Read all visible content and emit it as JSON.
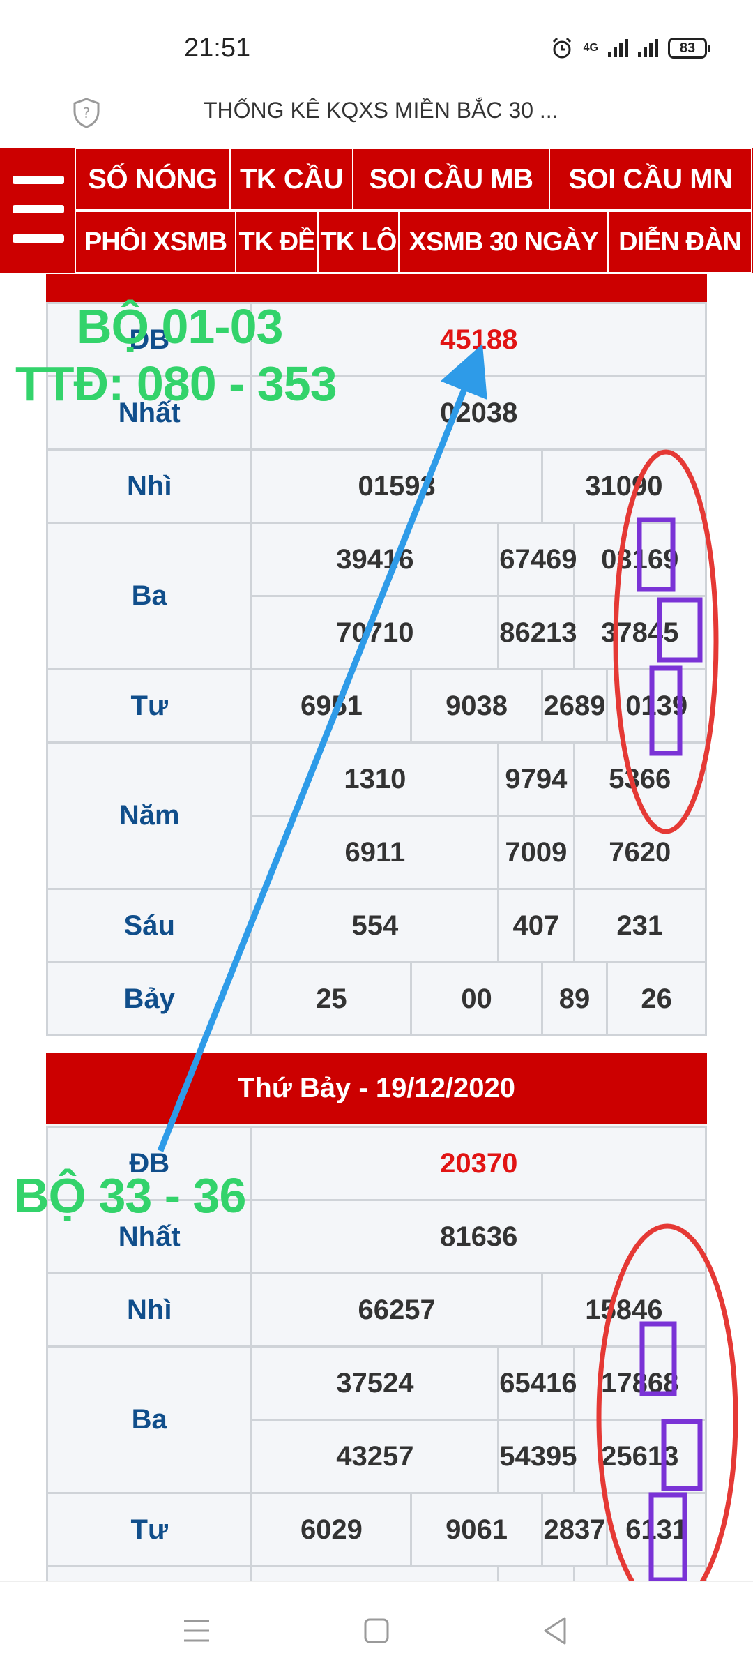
{
  "status_bar": {
    "time": "21:51",
    "network": "4G",
    "battery": "83"
  },
  "browser": {
    "title": "THỐNG KÊ KQXS MIỀN BẮC 30 ..."
  },
  "nav": {
    "row1": [
      "SỐ NÓNG",
      "TK CẦU",
      "SOI CẦU MB",
      "SOI CẦU MN"
    ],
    "row2": [
      "PHÔI XSMB",
      "TK ĐỀ",
      "TK LÔ",
      "XSMB 30 NGÀY",
      "DIỄN ĐÀN"
    ]
  },
  "prize_labels": {
    "db": "ĐB",
    "nhat": "Nhất",
    "nhi": "Nhì",
    "ba": "Ba",
    "tu": "Tư",
    "nam": "Năm",
    "sau": "Sáu",
    "bay": "Bảy"
  },
  "result_a": {
    "db": "45188",
    "nhat": "02038",
    "nhi": [
      "01593",
      "31090"
    ],
    "ba": [
      [
        "39416",
        "67469",
        "03169"
      ],
      [
        "70710",
        "86213",
        "37845"
      ]
    ],
    "tu": [
      "6951",
      "9038",
      "2689",
      "0139"
    ],
    "nam": [
      [
        "1310",
        "9794",
        "5366"
      ],
      [
        "6911",
        "7009",
        "7620"
      ]
    ],
    "sau": [
      "554",
      "407",
      "231"
    ],
    "bay": [
      "25",
      "00",
      "89",
      "26"
    ]
  },
  "result_b": {
    "header": "Thứ Bảy - 19/12/2020",
    "db": "20370",
    "nhat": "81636",
    "nhi": [
      "66257",
      "15846"
    ],
    "ba": [
      [
        "37524",
        "65416",
        "17868"
      ],
      [
        "43257",
        "54395",
        "25613"
      ]
    ],
    "tu": [
      "6029",
      "9061",
      "2837",
      "6131"
    ]
  },
  "annotations": {
    "note1": "BỘ 01-03",
    "note2": "TTĐ: 080 - 353",
    "note3": "BỘ 33 - 36",
    "colors": {
      "green": "#33d36b",
      "arrow": "#2e9be8",
      "circle": "#e53935",
      "box": "#7a33d6"
    }
  }
}
